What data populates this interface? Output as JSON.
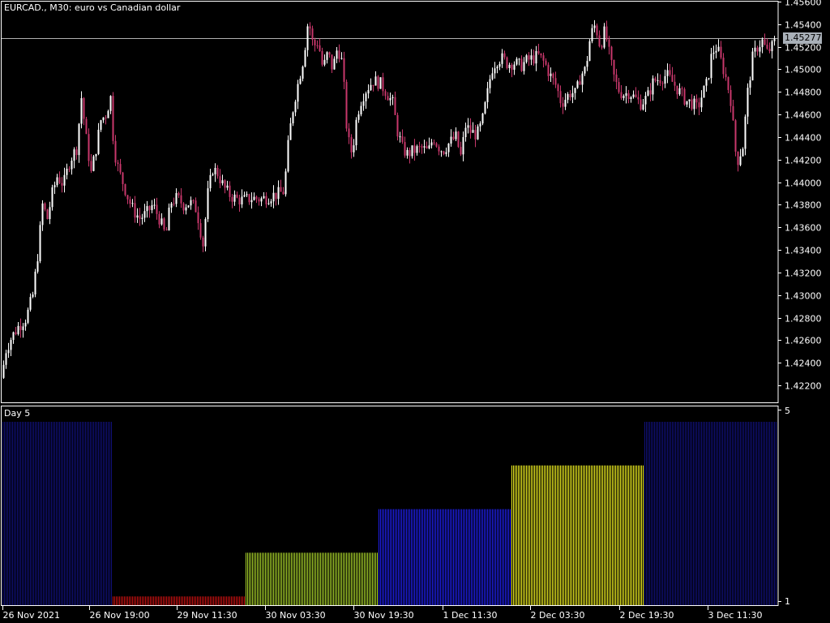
{
  "window": {
    "symbol": "EURCAD.,",
    "timeframe": "M30:",
    "description": "euro vs Canadian dollar"
  },
  "subwindow": {
    "label": "Day 5",
    "scale_top": "5",
    "scale_bottom": "1"
  },
  "current_price": "1.45277",
  "colors": {
    "background": "#000000",
    "candle_up": "#ffffff",
    "candle_down": "#c8376b",
    "grid_axis": "#ffffff",
    "price_line": "#b0b0b0",
    "day_colors": {
      "1": "#c81010",
      "2": "#a8d22a",
      "3": "#1f1ff0",
      "4": "#f0f020",
      "5": "#10107a"
    }
  },
  "chart_data": [
    {
      "type": "candlestick",
      "title": "EURCAD., M30: euro vs Canadian dollar",
      "ylim": [
        1.4205,
        1.456
      ],
      "y_ticks": [
        "1.45600",
        "1.45400",
        "1.45200",
        "1.45000",
        "1.44800",
        "1.44600",
        "1.44400",
        "1.44200",
        "1.44000",
        "1.43800",
        "1.43600",
        "1.43400",
        "1.43200",
        "1.43000",
        "1.42800",
        "1.42600",
        "1.42400",
        "1.42200"
      ],
      "x_ticks": [
        "26 Nov 2021",
        "26 Nov 19:00",
        "29 Nov 11:30",
        "30 Nov 03:30",
        "30 Nov 19:30",
        "1 Dec 11:30",
        "2 Dec 03:30",
        "2 Dec 19:30",
        "3 Dec 11:30"
      ],
      "current_price": 1.45277,
      "close_path": [
        [
          0,
          1.4215
        ],
        [
          6,
          1.425
        ],
        [
          14,
          1.4263
        ],
        [
          22,
          1.4272
        ],
        [
          32,
          1.428
        ],
        [
          40,
          1.43
        ],
        [
          46,
          1.4335
        ],
        [
          52,
          1.438
        ],
        [
          58,
          1.4368
        ],
        [
          64,
          1.439
        ],
        [
          70,
          1.4405
        ],
        [
          78,
          1.4398
        ],
        [
          86,
          1.442
        ],
        [
          94,
          1.443
        ],
        [
          100,
          1.4475
        ],
        [
          106,
          1.4438
        ],
        [
          112,
          1.4408
        ],
        [
          118,
          1.443
        ],
        [
          124,
          1.4455
        ],
        [
          130,
          1.446
        ],
        [
          136,
          1.4475
        ],
        [
          140,
          1.443
        ],
        [
          146,
          1.441
        ],
        [
          152,
          1.4398
        ],
        [
          158,
          1.4385
        ],
        [
          164,
          1.4375
        ],
        [
          172,
          1.4368
        ],
        [
          180,
          1.4372
        ],
        [
          188,
          1.438
        ],
        [
          196,
          1.4368
        ],
        [
          204,
          1.4352
        ],
        [
          210,
          1.4382
        ],
        [
          218,
          1.4386
        ],
        [
          226,
          1.438
        ],
        [
          234,
          1.4382
        ],
        [
          242,
          1.4376
        ],
        [
          250,
          1.4345
        ],
        [
          256,
          1.439
        ],
        [
          262,
          1.4412
        ],
        [
          268,
          1.4408
        ],
        [
          276,
          1.4395
        ],
        [
          284,
          1.4388
        ],
        [
          292,
          1.4385
        ],
        [
          300,
          1.4384
        ],
        [
          310,
          1.4386
        ],
        [
          322,
          1.4385
        ],
        [
          334,
          1.4388
        ],
        [
          344,
          1.439
        ],
        [
          350,
          1.4392
        ],
        [
          356,
          1.444
        ],
        [
          362,
          1.447
        ],
        [
          368,
          1.449
        ],
        [
          374,
          1.451
        ],
        [
          380,
          1.4545
        ],
        [
          386,
          1.452
        ],
        [
          392,
          1.4525
        ],
        [
          398,
          1.45
        ],
        [
          404,
          1.4515
        ],
        [
          410,
          1.45
        ],
        [
          416,
          1.452
        ],
        [
          422,
          1.4505
        ],
        [
          428,
          1.444
        ],
        [
          434,
          1.4425
        ],
        [
          440,
          1.446
        ],
        [
          446,
          1.4475
        ],
        [
          452,
          1.4483
        ],
        [
          460,
          1.449
        ],
        [
          468,
          1.4488
        ],
        [
          476,
          1.448
        ],
        [
          484,
          1.447
        ],
        [
          490,
          1.4445
        ],
        [
          496,
          1.443
        ],
        [
          502,
          1.4425
        ],
        [
          510,
          1.4428
        ],
        [
          520,
          1.443
        ],
        [
          528,
          1.4427
        ],
        [
          534,
          1.444
        ],
        [
          540,
          1.4432
        ],
        [
          546,
          1.4428
        ],
        [
          554,
          1.4435
        ],
        [
          562,
          1.444
        ],
        [
          568,
          1.4423
        ],
        [
          574,
          1.445
        ],
        [
          580,
          1.4445
        ],
        [
          588,
          1.4442
        ],
        [
          594,
          1.4452
        ],
        [
          600,
          1.4475
        ],
        [
          606,
          1.45
        ],
        [
          612,
          1.4508
        ],
        [
          618,
          1.451
        ],
        [
          626,
          1.4505
        ],
        [
          634,
          1.4506
        ],
        [
          642,
          1.4503
        ],
        [
          650,
          1.4508
        ],
        [
          658,
          1.451
        ],
        [
          664,
          1.4512
        ],
        [
          672,
          1.4505
        ],
        [
          678,
          1.4495
        ],
        [
          686,
          1.4485
        ],
        [
          692,
          1.447
        ],
        [
          698,
          1.4475
        ],
        [
          704,
          1.448
        ],
        [
          710,
          1.4478
        ],
        [
          716,
          1.4495
        ],
        [
          722,
          1.45
        ],
        [
          728,
          1.453
        ],
        [
          734,
          1.454
        ],
        [
          740,
          1.452
        ],
        [
          746,
          1.4535
        ],
        [
          752,
          1.451
        ],
        [
          758,
          1.449
        ],
        [
          764,
          1.448
        ],
        [
          770,
          1.4478
        ],
        [
          776,
          1.448
        ],
        [
          782,
          1.4475
        ],
        [
          790,
          1.447
        ],
        [
          798,
          1.4475
        ],
        [
          806,
          1.449
        ],
        [
          814,
          1.4492
        ],
        [
          822,
          1.4495
        ],
        [
          830,
          1.4488
        ],
        [
          838,
          1.448
        ],
        [
          846,
          1.4472
        ],
        [
          854,
          1.447
        ],
        [
          860,
          1.4465
        ],
        [
          866,
          1.4478
        ],
        [
          872,
          1.4488
        ],
        [
          878,
          1.4515
        ],
        [
          884,
          1.452
        ],
        [
          890,
          1.4505
        ],
        [
          896,
          1.449
        ],
        [
          902,
          1.447
        ],
        [
          906,
          1.443
        ],
        [
          910,
          1.442
        ],
        [
          916,
          1.4432
        ],
        [
          922,
          1.448
        ],
        [
          928,
          1.451
        ],
        [
          934,
          1.452
        ],
        [
          940,
          1.4525
        ],
        [
          946,
          1.4515
        ],
        [
          952,
          1.452
        ],
        [
          956,
          1.4525
        ]
      ]
    },
    {
      "type": "bar",
      "title": "Day 5",
      "ylim": [
        1,
        5
      ],
      "categories": [
        "26 Nov 2021",
        "29 Nov",
        "30 Nov",
        "1 Dec",
        "2 Dec",
        "3 Dec"
      ],
      "values": [
        5,
        1,
        2,
        3,
        4,
        5
      ],
      "day_color_keys": [
        "5",
        "1",
        "2",
        "3",
        "4",
        "5"
      ]
    }
  ]
}
